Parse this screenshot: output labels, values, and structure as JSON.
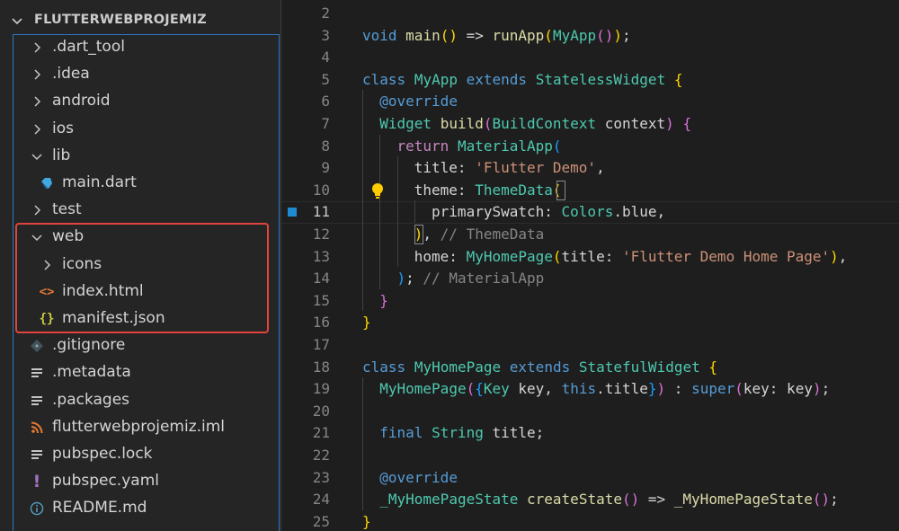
{
  "explorer": {
    "folder_name": "FLUTTERWEBPROJEMIZ",
    "items": [
      {
        "label": ".dart_tool",
        "icon": "chevron-right-icon",
        "depth": 1
      },
      {
        "label": ".idea",
        "icon": "chevron-right-icon",
        "depth": 1
      },
      {
        "label": "android",
        "icon": "chevron-right-icon",
        "depth": 1
      },
      {
        "label": "ios",
        "icon": "chevron-right-icon",
        "depth": 1
      },
      {
        "label": "lib",
        "icon": "chevron-down-icon",
        "depth": 1
      },
      {
        "label": "main.dart",
        "icon": "dart-file-icon",
        "depth": 2
      },
      {
        "label": "test",
        "icon": "chevron-right-icon",
        "depth": 1
      },
      {
        "label": "web",
        "icon": "chevron-down-icon",
        "depth": 1
      },
      {
        "label": "icons",
        "icon": "chevron-right-icon",
        "depth": 2
      },
      {
        "label": "index.html",
        "icon": "html-file-icon",
        "depth": 2
      },
      {
        "label": "manifest.json",
        "icon": "json-file-icon",
        "depth": 2
      },
      {
        "label": ".gitignore",
        "icon": "git-file-icon",
        "depth": 1
      },
      {
        "label": ".metadata",
        "icon": "text-file-icon",
        "depth": 1
      },
      {
        "label": ".packages",
        "icon": "text-file-icon",
        "depth": 1
      },
      {
        "label": "flutterwebprojemiz.iml",
        "icon": "rss-file-icon",
        "depth": 1
      },
      {
        "label": "pubspec.lock",
        "icon": "text-file-icon",
        "depth": 1
      },
      {
        "label": "pubspec.yaml",
        "icon": "yaml-file-icon",
        "depth": 1
      },
      {
        "label": "README.md",
        "icon": "info-file-icon",
        "depth": 1
      }
    ]
  },
  "editor": {
    "active_line": 11,
    "lines": [
      {
        "n": "2",
        "indent": 0,
        "tokens": []
      },
      {
        "n": "3",
        "indent": 0,
        "tokens": [
          [
            "k",
            "void"
          ],
          [
            "p",
            " "
          ],
          [
            "f",
            "main"
          ],
          [
            "b1",
            "()"
          ],
          [
            "p",
            " => "
          ],
          [
            "f",
            "runApp"
          ],
          [
            "b1",
            "("
          ],
          [
            "t",
            "MyApp"
          ],
          [
            "b2",
            "()"
          ],
          [
            "b1",
            ")"
          ],
          [
            "p",
            ";"
          ]
        ]
      },
      {
        "n": "4",
        "indent": 0,
        "tokens": []
      },
      {
        "n": "5",
        "indent": 0,
        "tokens": [
          [
            "k",
            "class"
          ],
          [
            "p",
            " "
          ],
          [
            "t",
            "MyApp"
          ],
          [
            "p",
            " "
          ],
          [
            "k",
            "extends"
          ],
          [
            "p",
            " "
          ],
          [
            "t",
            "StatelessWidget"
          ],
          [
            "p",
            " "
          ],
          [
            "b1",
            "{"
          ]
        ]
      },
      {
        "n": "6",
        "indent": 1,
        "tokens": [
          [
            "k",
            "@override"
          ]
        ]
      },
      {
        "n": "7",
        "indent": 1,
        "tokens": [
          [
            "t",
            "Widget"
          ],
          [
            "p",
            " "
          ],
          [
            "f",
            "build"
          ],
          [
            "b2",
            "("
          ],
          [
            "t",
            "BuildContext"
          ],
          [
            "p",
            " context"
          ],
          [
            "b2",
            ")"
          ],
          [
            "p",
            " "
          ],
          [
            "b2",
            "{"
          ]
        ]
      },
      {
        "n": "8",
        "indent": 2,
        "tokens": [
          [
            "ctl",
            "return"
          ],
          [
            "p",
            " "
          ],
          [
            "t",
            "MaterialApp"
          ],
          [
            "b3",
            "("
          ]
        ]
      },
      {
        "n": "9",
        "indent": 3,
        "tokens": [
          [
            "p",
            "title: "
          ],
          [
            "s",
            "'Flutter Demo'"
          ],
          [
            "p",
            ","
          ]
        ]
      },
      {
        "n": "10",
        "indent": 3,
        "tokens": [
          [
            "p",
            "theme: "
          ],
          [
            "t",
            "ThemeData"
          ],
          [
            "b1",
            "("
          ]
        ]
      },
      {
        "n": "11",
        "indent": 4,
        "tokens": [
          [
            "p",
            "primarySwatch: "
          ],
          [
            "t",
            "Colors"
          ],
          [
            "p",
            ".blue,"
          ]
        ]
      },
      {
        "n": "12",
        "indent": 3,
        "tokens": [
          [
            "b1",
            ")"
          ],
          [
            "p",
            ", "
          ],
          [
            "cm",
            "// ThemeData"
          ]
        ]
      },
      {
        "n": "13",
        "indent": 3,
        "tokens": [
          [
            "p",
            "home: "
          ],
          [
            "t",
            "MyHomePage"
          ],
          [
            "b1",
            "("
          ],
          [
            "p",
            "title: "
          ],
          [
            "s",
            "'Flutter Demo Home Page'"
          ],
          [
            "b1",
            ")"
          ],
          [
            "p",
            ","
          ]
        ]
      },
      {
        "n": "14",
        "indent": 2,
        "tokens": [
          [
            "b3",
            ")"
          ],
          [
            "p",
            "; "
          ],
          [
            "cm",
            "// MaterialApp"
          ]
        ]
      },
      {
        "n": "15",
        "indent": 1,
        "tokens": [
          [
            "b2",
            "}"
          ]
        ]
      },
      {
        "n": "16",
        "indent": 0,
        "tokens": [
          [
            "b1",
            "}"
          ]
        ]
      },
      {
        "n": "17",
        "indent": 0,
        "tokens": []
      },
      {
        "n": "18",
        "indent": 0,
        "tokens": [
          [
            "k",
            "class"
          ],
          [
            "p",
            " "
          ],
          [
            "t",
            "MyHomePage"
          ],
          [
            "p",
            " "
          ],
          [
            "k",
            "extends"
          ],
          [
            "p",
            " "
          ],
          [
            "t",
            "StatefulWidget"
          ],
          [
            "p",
            " "
          ],
          [
            "b1",
            "{"
          ]
        ]
      },
      {
        "n": "19",
        "indent": 1,
        "tokens": [
          [
            "t",
            "MyHomePage"
          ],
          [
            "b2",
            "("
          ],
          [
            "b3",
            "{"
          ],
          [
            "t",
            "Key"
          ],
          [
            "p",
            " key, "
          ],
          [
            "k",
            "this"
          ],
          [
            "p",
            ".title"
          ],
          [
            "b3",
            "}"
          ],
          [
            "b2",
            ")"
          ],
          [
            "p",
            " : "
          ],
          [
            "k",
            "super"
          ],
          [
            "b2",
            "("
          ],
          [
            "p",
            "key: key"
          ],
          [
            "b2",
            ")"
          ],
          [
            "p",
            ";"
          ]
        ]
      },
      {
        "n": "20",
        "indent": 0,
        "tokens": []
      },
      {
        "n": "21",
        "indent": 1,
        "tokens": [
          [
            "k",
            "final"
          ],
          [
            "p",
            " "
          ],
          [
            "t",
            "String"
          ],
          [
            "p",
            " title;"
          ]
        ]
      },
      {
        "n": "22",
        "indent": 0,
        "tokens": []
      },
      {
        "n": "23",
        "indent": 1,
        "tokens": [
          [
            "k",
            "@override"
          ]
        ]
      },
      {
        "n": "24",
        "indent": 1,
        "tokens": [
          [
            "t",
            "_MyHomePageState"
          ],
          [
            "p",
            " "
          ],
          [
            "f",
            "createState"
          ],
          [
            "b2",
            "()"
          ],
          [
            "p",
            " => "
          ],
          [
            "f",
            "_MyHomePageState"
          ],
          [
            "b2",
            "()"
          ],
          [
            "p",
            ";"
          ]
        ]
      },
      {
        "n": "25",
        "indent": 0,
        "tokens": [
          [
            "b1",
            "}"
          ]
        ]
      }
    ]
  }
}
